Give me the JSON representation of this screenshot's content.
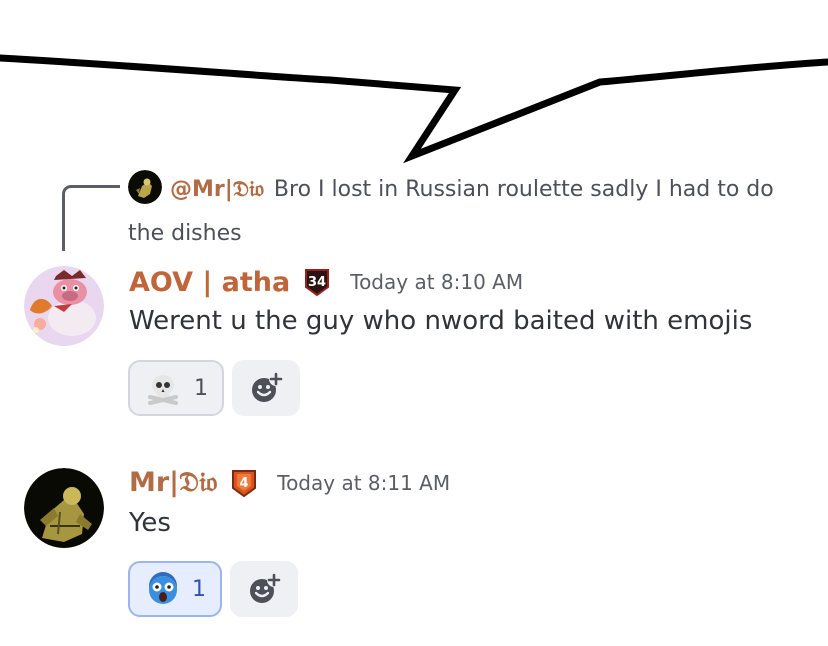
{
  "reply": {
    "mention": "@Mr|𝔇𝔦𝔬",
    "text": "Bro I lost in Russian roulette sadly I had to do the dishes"
  },
  "messages": [
    {
      "username": "AOV | atha",
      "username_color": "#c0643a",
      "role_badge": "34",
      "timestamp": "Today at 8:10 AM",
      "content": "Werent u the guy who nword baited with emojis",
      "reactions": [
        {
          "emoji": "skull-icon",
          "count": "1",
          "me": false
        }
      ]
    },
    {
      "username": "Mr|𝔇𝔦𝔬",
      "username_color": "#b26c45",
      "role_badge": "4",
      "timestamp": "Today at 8:11 AM",
      "content": "Yes",
      "reactions": [
        {
          "emoji": "scared-face-icon",
          "count": "1",
          "me": true
        }
      ]
    }
  ],
  "colors": {
    "accent_blue": "#5865f2",
    "reaction_me_bg": "#e5edff",
    "reaction_bg": "#eff0f3"
  }
}
